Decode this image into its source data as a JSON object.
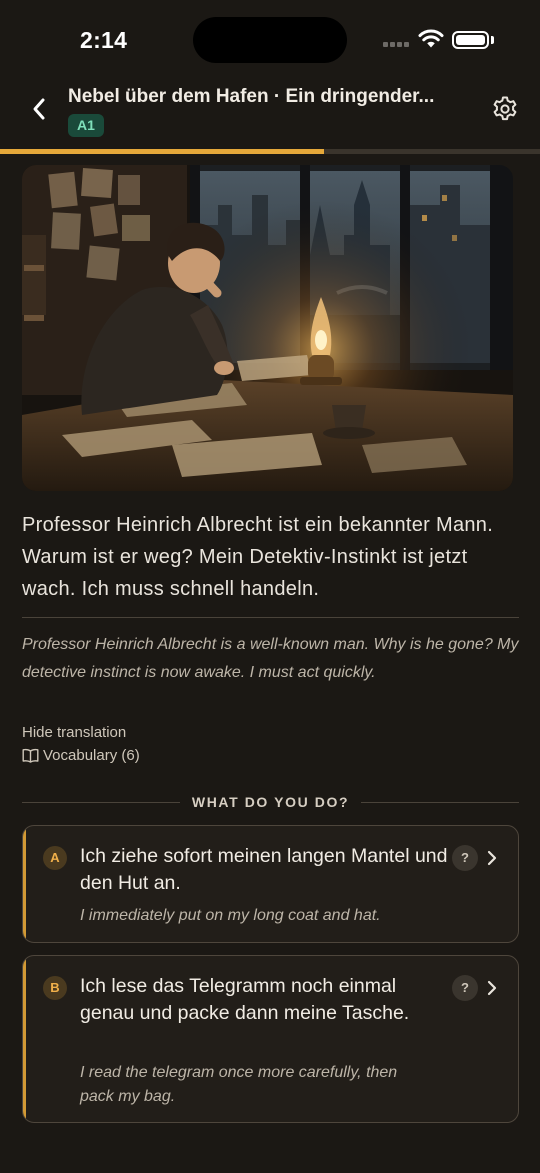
{
  "status_bar": {
    "time": "2:14"
  },
  "header": {
    "title": "Nebel über dem Hafen · Ein dringender...",
    "level": "A1",
    "progress_percent": 60
  },
  "story": {
    "text": "Professor Heinrich Albrecht ist ein bekannter Mann. Warum ist er weg? Mein Detektiv-Instinkt ist jetzt wach. Ich muss schnell handeln.",
    "translation": "Professor Heinrich Albrecht is a well-known man. Why is he gone? My detective instinct is now awake. I must act quickly.",
    "toggle_translation_label": "Hide translation",
    "vocabulary_label": "Vocabulary (6)"
  },
  "choices_heading": "WHAT DO YOU DO?",
  "choices": [
    {
      "letter": "A",
      "text": "Ich ziehe sofort meinen langen Mantel und den Hut an.",
      "translation": "I immediately put on my long coat and hat.",
      "help": "?"
    },
    {
      "letter": "B",
      "text": "Ich lese das Telegramm noch einmal genau und packe dann meine Tasche.",
      "translation": "I read the telegram once more carefully, then pack my bag.",
      "help": "?"
    }
  ],
  "colors": {
    "background": "#1b1814",
    "accent": "#e5a83a",
    "level_badge": "#1a4a3a",
    "level_badge_text": "#7fe0ba"
  }
}
